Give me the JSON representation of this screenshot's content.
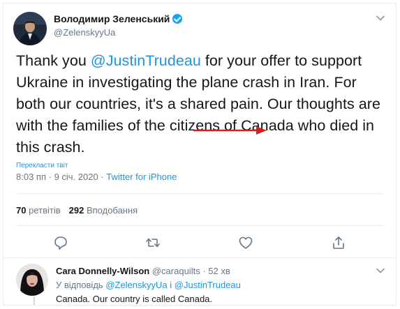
{
  "tweet": {
    "author_name": "Володимир Зеленський",
    "author_handle": "@ZelenskyyUa",
    "text_before": "Thank you ",
    "mention": "@JustinTrudeau",
    "text_after": " for your offer to support Ukraine in investigating the plane crash in Iran. For both our countries, it's a shared pain. Our thoughts are with the families of the citizens of Canada who died in this crash.",
    "translate_label": "Перекласти твіт",
    "time": "8:03 пп",
    "date": "9 січ. 2020",
    "source": "Twitter for iPhone",
    "separator": " · ",
    "retweet_count": "70",
    "retweet_label": "ретвітів",
    "like_count": "292",
    "like_label": "Вподобання"
  },
  "actions": {
    "reply_icon": "reply-icon",
    "retweet_icon": "retweet-icon",
    "like_icon": "heart-icon",
    "share_icon": "share-icon"
  },
  "reply": {
    "author_name": "Cara Donnelly-Wilson",
    "author_handle": "@caraquilts",
    "age": "52 хв",
    "reply_prefix": "У відповідь",
    "reply_to_1": "@ZelenskyyUa",
    "reply_joiner": "і",
    "reply_to_2": "@JustinTrudeau",
    "text": "Canada. Our country is called Canada."
  },
  "colors": {
    "accent": "#1b95e0",
    "annotation_arrow": "#d42020",
    "verified": "#1da1f2"
  }
}
